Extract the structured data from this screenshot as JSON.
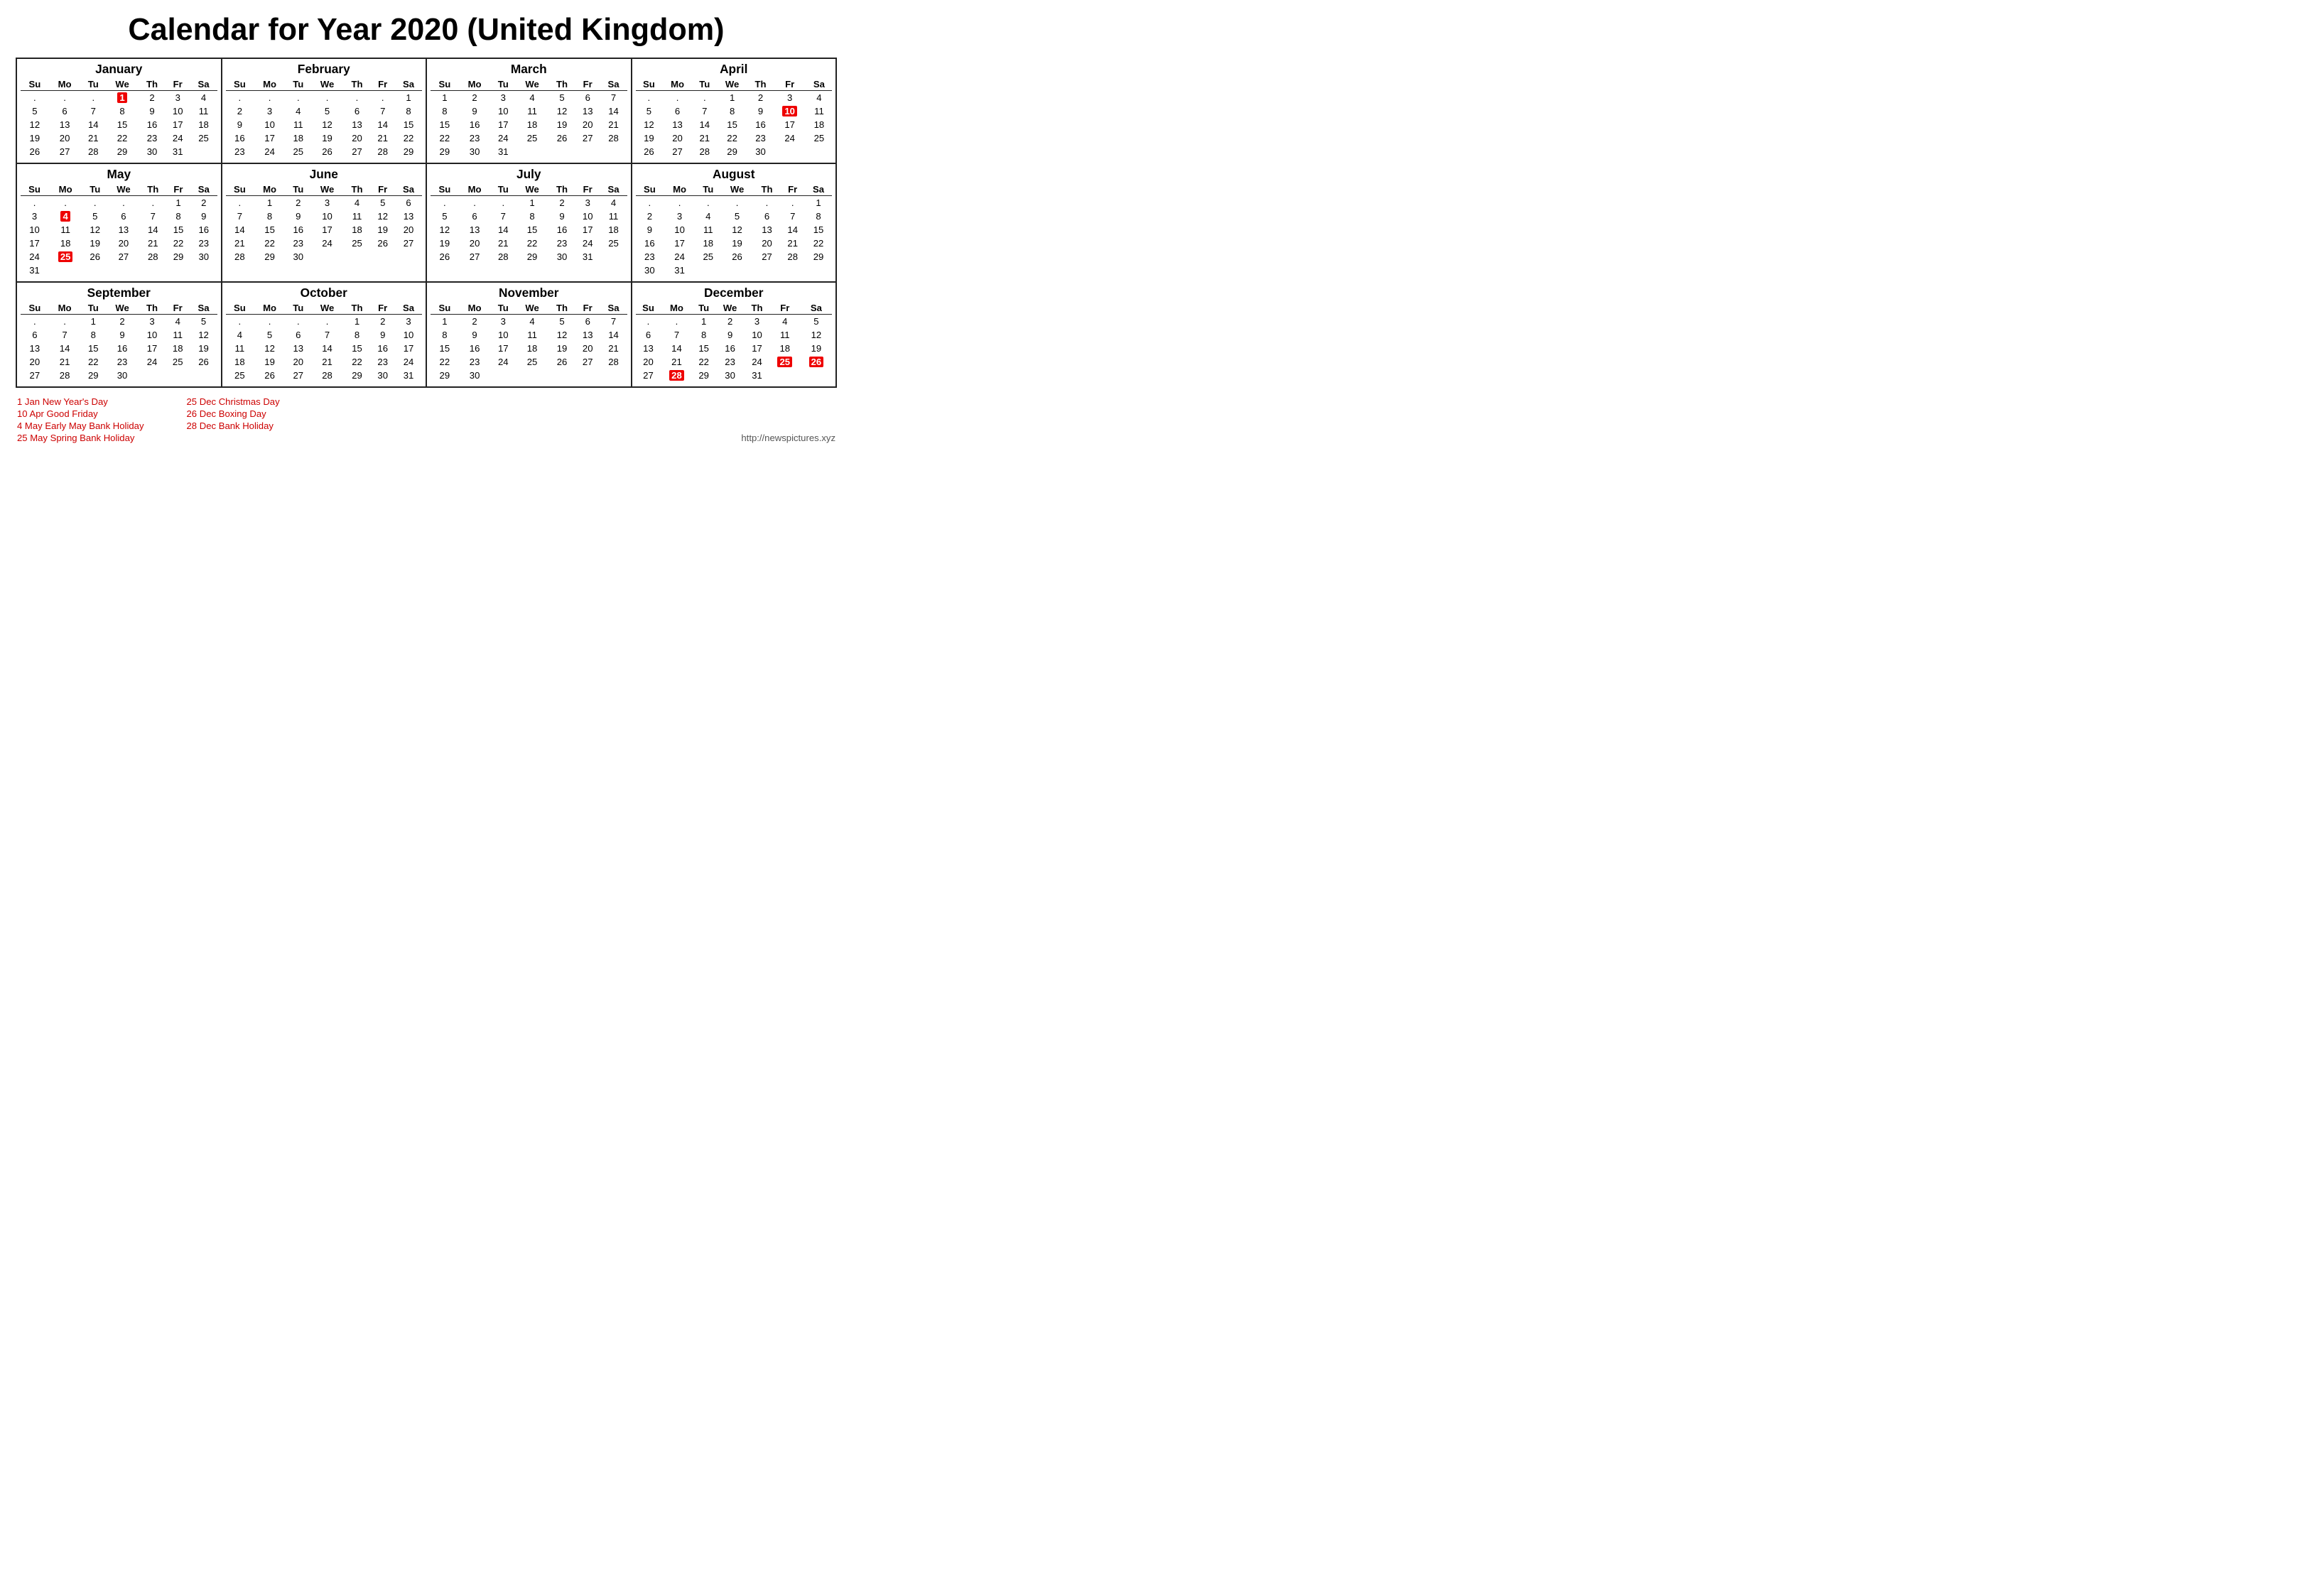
{
  "title": "Calendar for Year 2020 (United Kingdom)",
  "months": [
    {
      "name": "January",
      "days_header": [
        "Su",
        "Mo",
        "Tu",
        "We",
        "Th",
        "Fr",
        "Sa"
      ],
      "weeks": [
        [
          ".",
          ".",
          ".",
          "1",
          "2",
          "3",
          "4"
        ],
        [
          "5",
          "6",
          "7",
          "8",
          "9",
          "10",
          "11"
        ],
        [
          "12",
          "13",
          "14",
          "15",
          "16",
          "17",
          "18"
        ],
        [
          "19",
          "20",
          "21",
          "22",
          "23",
          "24",
          "25"
        ],
        [
          "26",
          "27",
          "28",
          "29",
          "30",
          "31",
          ""
        ]
      ],
      "holidays": {
        "1": true
      }
    },
    {
      "name": "February",
      "days_header": [
        "Su",
        "Mo",
        "Tu",
        "We",
        "Th",
        "Fr",
        "Sa"
      ],
      "weeks": [
        [
          ".",
          ".",
          ".",
          ".",
          ".",
          ".",
          "1"
        ],
        [
          "2",
          "3",
          "4",
          "5",
          "6",
          "7",
          "8"
        ],
        [
          "9",
          "10",
          "11",
          "12",
          "13",
          "14",
          "15"
        ],
        [
          "16",
          "17",
          "18",
          "19",
          "20",
          "21",
          "22"
        ],
        [
          "23",
          "24",
          "25",
          "26",
          "27",
          "28",
          "29"
        ]
      ],
      "holidays": {}
    },
    {
      "name": "March",
      "days_header": [
        "Su",
        "Mo",
        "Tu",
        "We",
        "Th",
        "Fr",
        "Sa"
      ],
      "weeks": [
        [
          "1",
          "2",
          "3",
          "4",
          "5",
          "6",
          "7"
        ],
        [
          "8",
          "9",
          "10",
          "11",
          "12",
          "13",
          "14"
        ],
        [
          "15",
          "16",
          "17",
          "18",
          "19",
          "20",
          "21"
        ],
        [
          "22",
          "23",
          "24",
          "25",
          "26",
          "27",
          "28"
        ],
        [
          "29",
          "30",
          "31",
          "",
          "",
          "",
          ""
        ]
      ],
      "holidays": {}
    },
    {
      "name": "April",
      "days_header": [
        "Su",
        "Mo",
        "Tu",
        "We",
        "Th",
        "Fr",
        "Sa"
      ],
      "weeks": [
        [
          ".",
          ".",
          ".",
          "1",
          "2",
          "3",
          "4"
        ],
        [
          "5",
          "6",
          "7",
          "8",
          "9",
          "10",
          "11"
        ],
        [
          "12",
          "13",
          "14",
          "15",
          "16",
          "17",
          "18"
        ],
        [
          "19",
          "20",
          "21",
          "22",
          "23",
          "24",
          "25"
        ],
        [
          "26",
          "27",
          "28",
          "29",
          "30",
          "",
          ""
        ]
      ],
      "holidays": {
        "10": true
      }
    },
    {
      "name": "May",
      "days_header": [
        "Su",
        "Mo",
        "Tu",
        "We",
        "Th",
        "Fr",
        "Sa"
      ],
      "weeks": [
        [
          ".",
          ".",
          ".",
          ".",
          ".",
          "1",
          "2"
        ],
        [
          "3",
          "4",
          "5",
          "6",
          "7",
          "8",
          "9"
        ],
        [
          "10",
          "11",
          "12",
          "13",
          "14",
          "15",
          "16"
        ],
        [
          "17",
          "18",
          "19",
          "20",
          "21",
          "22",
          "23"
        ],
        [
          "24",
          "25",
          "26",
          "27",
          "28",
          "29",
          "30"
        ],
        [
          "31",
          "",
          "",
          "",
          "",
          "",
          ""
        ]
      ],
      "holidays": {
        "4": true,
        "25": true
      }
    },
    {
      "name": "June",
      "days_header": [
        "Su",
        "Mo",
        "Tu",
        "We",
        "Th",
        "Fr",
        "Sa"
      ],
      "weeks": [
        [
          ".",
          "1",
          "2",
          "3",
          "4",
          "5",
          "6"
        ],
        [
          "7",
          "8",
          "9",
          "10",
          "11",
          "12",
          "13"
        ],
        [
          "14",
          "15",
          "16",
          "17",
          "18",
          "19",
          "20"
        ],
        [
          "21",
          "22",
          "23",
          "24",
          "25",
          "26",
          "27"
        ],
        [
          "28",
          "29",
          "30",
          "",
          "",
          "",
          ""
        ]
      ],
      "holidays": {}
    },
    {
      "name": "July",
      "days_header": [
        "Su",
        "Mo",
        "Tu",
        "We",
        "Th",
        "Fr",
        "Sa"
      ],
      "weeks": [
        [
          ".",
          ".",
          ".",
          "1",
          "2",
          "3",
          "4"
        ],
        [
          "5",
          "6",
          "7",
          "8",
          "9",
          "10",
          "11"
        ],
        [
          "12",
          "13",
          "14",
          "15",
          "16",
          "17",
          "18"
        ],
        [
          "19",
          "20",
          "21",
          "22",
          "23",
          "24",
          "25"
        ],
        [
          "26",
          "27",
          "28",
          "29",
          "30",
          "31",
          ""
        ]
      ],
      "holidays": {}
    },
    {
      "name": "August",
      "days_header": [
        "Su",
        "Mo",
        "Tu",
        "We",
        "Th",
        "Fr",
        "Sa"
      ],
      "weeks": [
        [
          ".",
          ".",
          ".",
          ".",
          ".",
          ".",
          "1"
        ],
        [
          "2",
          "3",
          "4",
          "5",
          "6",
          "7",
          "8"
        ],
        [
          "9",
          "10",
          "11",
          "12",
          "13",
          "14",
          "15"
        ],
        [
          "16",
          "17",
          "18",
          "19",
          "20",
          "21",
          "22"
        ],
        [
          "23",
          "24",
          "25",
          "26",
          "27",
          "28",
          "29"
        ],
        [
          "30",
          "31",
          "",
          "",
          "",
          "",
          ""
        ]
      ],
      "holidays": {}
    },
    {
      "name": "September",
      "days_header": [
        "Su",
        "Mo",
        "Tu",
        "We",
        "Th",
        "Fr",
        "Sa"
      ],
      "weeks": [
        [
          ".",
          ".",
          "1",
          "2",
          "3",
          "4",
          "5"
        ],
        [
          "6",
          "7",
          "8",
          "9",
          "10",
          "11",
          "12"
        ],
        [
          "13",
          "14",
          "15",
          "16",
          "17",
          "18",
          "19"
        ],
        [
          "20",
          "21",
          "22",
          "23",
          "24",
          "25",
          "26"
        ],
        [
          "27",
          "28",
          "29",
          "30",
          "",
          "",
          ""
        ]
      ],
      "holidays": {}
    },
    {
      "name": "October",
      "days_header": [
        "Su",
        "Mo",
        "Tu",
        "We",
        "Th",
        "Fr",
        "Sa"
      ],
      "weeks": [
        [
          ".",
          ".",
          ".",
          ".",
          "1",
          "2",
          "3"
        ],
        [
          "4",
          "5",
          "6",
          "7",
          "8",
          "9",
          "10"
        ],
        [
          "11",
          "12",
          "13",
          "14",
          "15",
          "16",
          "17"
        ],
        [
          "18",
          "19",
          "20",
          "21",
          "22",
          "23",
          "24"
        ],
        [
          "25",
          "26",
          "27",
          "28",
          "29",
          "30",
          "31"
        ]
      ],
      "holidays": {}
    },
    {
      "name": "November",
      "days_header": [
        "Su",
        "Mo",
        "Tu",
        "We",
        "Th",
        "Fr",
        "Sa"
      ],
      "weeks": [
        [
          "1",
          "2",
          "3",
          "4",
          "5",
          "6",
          "7"
        ],
        [
          "8",
          "9",
          "10",
          "11",
          "12",
          "13",
          "14"
        ],
        [
          "15",
          "16",
          "17",
          "18",
          "19",
          "20",
          "21"
        ],
        [
          "22",
          "23",
          "24",
          "25",
          "26",
          "27",
          "28"
        ],
        [
          "29",
          "30",
          "",
          "",
          "",
          "",
          ""
        ]
      ],
      "holidays": {}
    },
    {
      "name": "December",
      "days_header": [
        "Su",
        "Mo",
        "Tu",
        "We",
        "Th",
        "Fr",
        "Sa"
      ],
      "weeks": [
        [
          ".",
          ".",
          "1",
          "2",
          "3",
          "4",
          "5"
        ],
        [
          "6",
          "7",
          "8",
          "9",
          "10",
          "11",
          "12"
        ],
        [
          "13",
          "14",
          "15",
          "16",
          "17",
          "18",
          "19"
        ],
        [
          "20",
          "21",
          "22",
          "23",
          "24",
          "25",
          "26"
        ],
        [
          "27",
          "28",
          "29",
          "30",
          "31",
          "",
          ""
        ]
      ],
      "holidays": {
        "25": true,
        "26": true,
        "28": true
      }
    }
  ],
  "holidays_left": [
    "1 Jan New Year's Day",
    "10 Apr Good Friday",
    "4 May Early May Bank Holiday",
    "25 May Spring Bank Holiday"
  ],
  "holidays_right": [
    "25 Dec Christmas Day",
    "26 Dec Boxing Day",
    "28 Dec Bank Holiday"
  ],
  "website": "http://newspictures.xyz"
}
